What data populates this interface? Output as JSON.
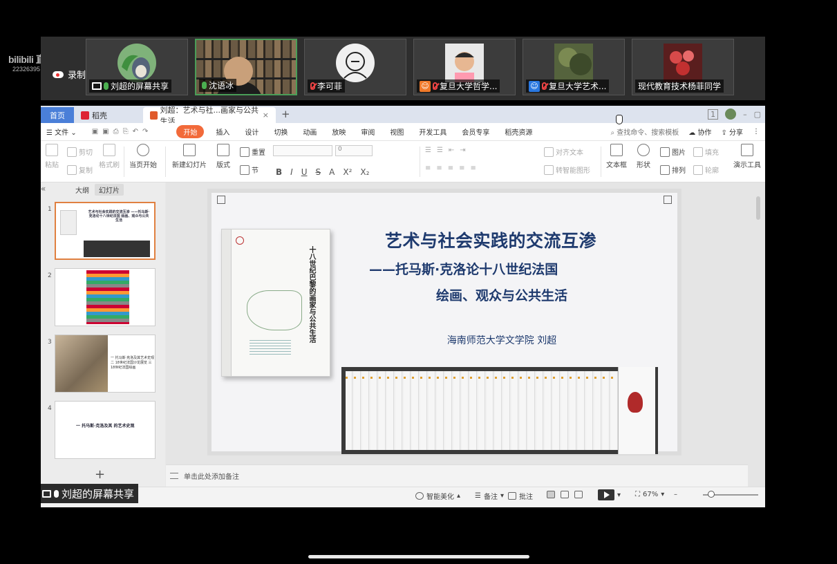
{
  "overlay": {
    "platform_logo": "bilibili 直播",
    "room_id": "22326395"
  },
  "meeting": {
    "recording_label": "录制中",
    "participants": [
      {
        "name": "刘超的屏幕共享",
        "mic": "on",
        "badge": "share-icon",
        "avatar_color": "#7fb27a"
      },
      {
        "name": "沈语冰",
        "mic": "on",
        "badge": "",
        "avatar_color": ""
      },
      {
        "name": "李可菲",
        "mic": "muted",
        "badge": "",
        "avatar_color": "#f0f0f0"
      },
      {
        "name": "复旦大学哲学...",
        "mic": "muted",
        "badge": "user-icon",
        "badge_color": "#f07a2a",
        "avatar_color": "#f2c9a8"
      },
      {
        "name": "复旦大学艺术...",
        "mic": "muted",
        "badge": "user-icon",
        "badge_color": "#2a78e0",
        "avatar_color": "#6b7a4e"
      },
      {
        "name": "现代教育技术杨菲同学",
        "mic": "none",
        "badge": "",
        "avatar_color": "#b33a3a"
      }
    ]
  },
  "app": {
    "tabs": {
      "home": "首页",
      "wps": "稻壳",
      "file": "刘超：艺术与社...画家与公共生活",
      "close": "×",
      "add": "+"
    },
    "window_controls": {
      "layout": "1",
      "minimize": "–",
      "restore": "▢"
    },
    "menu": {
      "file": "文件",
      "items": [
        "开始",
        "插入",
        "设计",
        "切换",
        "动画",
        "放映",
        "审阅",
        "视图",
        "开发工具",
        "会员专享",
        "稻壳资源"
      ],
      "selected": "开始",
      "search": "查找命令、搜索模板",
      "collab": "协作",
      "share": "分享"
    },
    "ribbon": {
      "paste": "粘贴",
      "cut": "剪切",
      "copy": "复制",
      "format_painter": "格式刷",
      "play_from_current": "当页开始",
      "new_slide": "新建幻灯片",
      "layout": "版式",
      "reset": "重置",
      "section": "节",
      "font_size_value": "0",
      "bold": "B",
      "italic": "I",
      "underline": "U",
      "strike": "S",
      "font_color": "A",
      "superscript": "X²",
      "subscript": "X₂",
      "align_text": "对齐文本",
      "smartart": "转智能图形",
      "textbox": "文本框",
      "shape": "形状",
      "picture": "图片",
      "fill": "填充",
      "arrange": "排列",
      "outline": "轮廓",
      "presentation_tools": "演示工具"
    },
    "panel": {
      "outline_tab": "大纲",
      "slides_tab": "幻灯片",
      "collapse": "«",
      "slide_numbers": [
        "1",
        "2",
        "3",
        "4"
      ],
      "thumb1_text": "艺术与社会实践的交流互渗 ——托马斯·克洛论十八世纪法国 绘画、观众与公共生活",
      "thumb3_text": "一 托马斯·克洛及其艺术史观 二 18世纪法国沙龙展览 三 18世纪法国绘画",
      "thumb4_text": "一 托马斯·克洛及其 的艺术史观",
      "add": "+"
    },
    "slide": {
      "title": "艺术与社会实践的交流互渗",
      "subtitle_line1": "——托马斯·克洛论十八世纪法国",
      "subtitle_line2": "绘画、观众与公共生活",
      "author": "海南师范大学文学院  刘超",
      "book_title": "十八世纪巴黎的画家与公共生活"
    },
    "notes_placeholder": "单击此处添加备注",
    "statusbar": {
      "smart_beautify": "智能美化",
      "notes": "备注",
      "comments": "批注",
      "zoom": "67%",
      "zoom_minus": "–",
      "zoom_level": 0.15
    },
    "share_label": "刘超的屏幕共享"
  }
}
